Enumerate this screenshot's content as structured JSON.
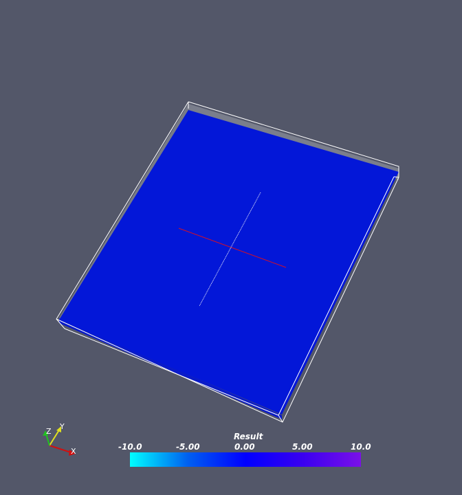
{
  "colors": {
    "background": "#535769",
    "surface": "#0317d8",
    "surface_side": "#0a1bc8",
    "outline": "#ffffff",
    "x_axis": "#d0102a",
    "y_axis": "#ffffff"
  },
  "orientation_axes": {
    "x_label": "X",
    "y_label": "Y",
    "z_label": "Z",
    "x_color": "#d01010",
    "y_color": "#e0e020",
    "z_color": "#20c020"
  },
  "colorbar": {
    "title": "Result",
    "ticks": [
      "-10.0",
      "-5.00",
      "0.00",
      "5.00",
      "10.0"
    ],
    "range": [
      -10.0,
      10.0
    ],
    "gradient": [
      "#00ffff",
      "#0060f0",
      "#0000ff",
      "#3a00f0",
      "#7a10e8"
    ]
  }
}
